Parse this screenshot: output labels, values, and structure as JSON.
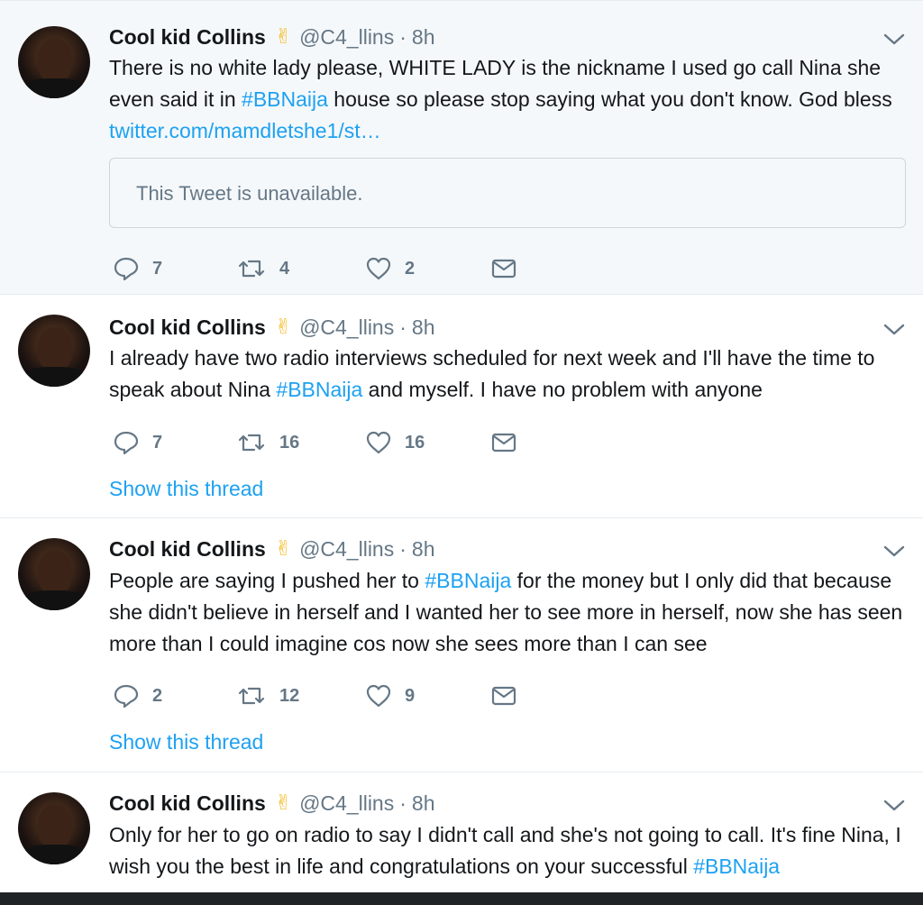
{
  "tweets": [
    {
      "name": "Cool kid Collins",
      "emoji": "✌",
      "handle": "@C4_llins",
      "time": "8h",
      "text_before": "There is no white lady please, WHITE LADY is the nickname I used go call Nina she even said it in ",
      "hashtag": "#BBNaija",
      "text_after": " house so please stop saying what you don't know. God bless ",
      "link": "twitter.com/mamdletshe1/st…",
      "quote": "This Tweet is unavailable.",
      "replies": "7",
      "retweets": "4",
      "likes": "2"
    },
    {
      "name": "Cool kid Collins",
      "emoji": "✌",
      "handle": "@C4_llins",
      "time": "8h",
      "text_before": "I already have two radio interviews scheduled for next week and I'll have the time to speak about Nina ",
      "hashtag": "#BBNaija",
      "text_after": " and myself. I have no problem with anyone",
      "replies": "7",
      "retweets": "16",
      "likes": "16",
      "thread_label": "Show this thread"
    },
    {
      "name": "Cool kid Collins",
      "emoji": "✌",
      "handle": "@C4_llins",
      "time": "8h",
      "text_before": "People are saying I pushed her to ",
      "hashtag": "#BBNaija",
      "text_after": " for the money but I only did that because she didn't believe in herself and I wanted her to see more in herself, now she has seen more than I could imagine cos now she sees more than I can see",
      "replies": "2",
      "retweets": "12",
      "likes": "9",
      "thread_label": "Show this thread"
    },
    {
      "name": "Cool kid Collins",
      "emoji": "✌",
      "handle": "@C4_llins",
      "time": "8h",
      "text_before": "Only for her to go on radio to say I didn't call and she's not going to call. It's fine Nina, I wish you the best in life and congratulations on your successful ",
      "hashtag": "#BBNaija",
      "text_after": ""
    }
  ],
  "colors": {
    "link": "#1da1f2",
    "muted": "#657786",
    "highlight_bg": "#f5f8fa"
  },
  "icons": [
    "reply-icon",
    "retweet-icon",
    "like-icon",
    "dm-icon",
    "caret-down-icon",
    "victory-hand-emoji"
  ]
}
